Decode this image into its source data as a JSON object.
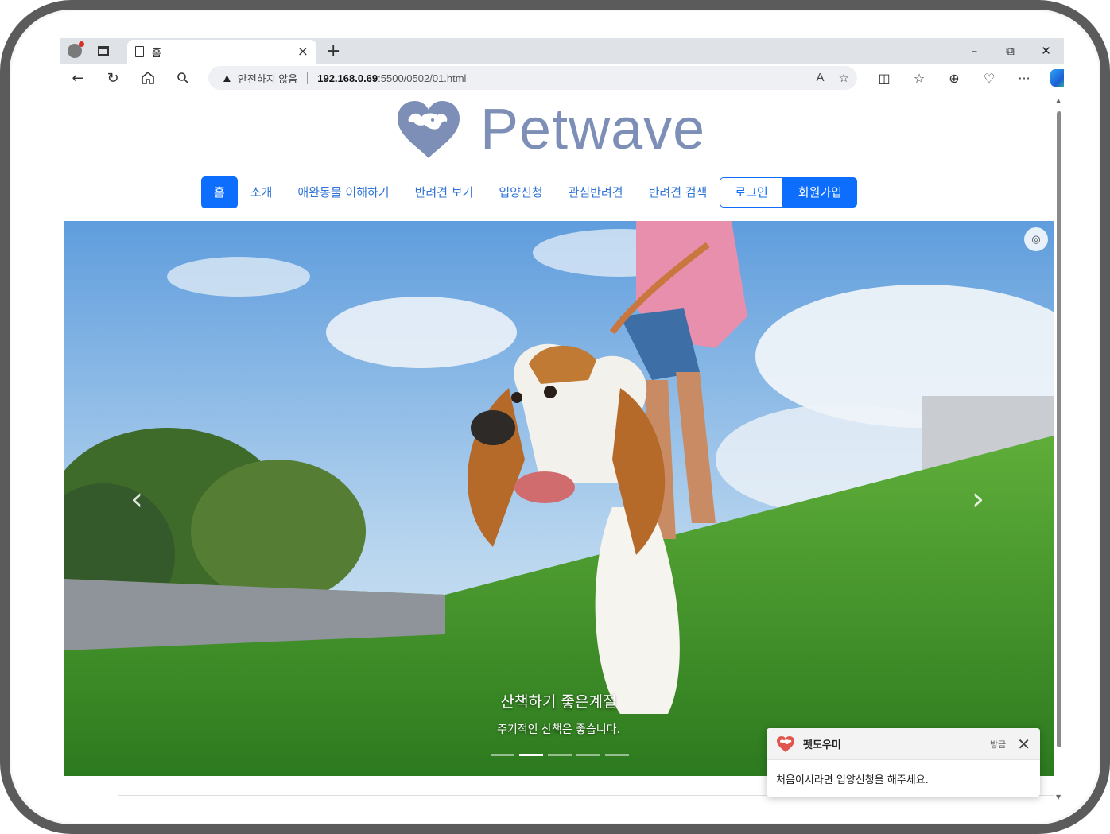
{
  "browser": {
    "tab_title": "홈",
    "tab_close": "×",
    "new_tab": "+",
    "window_controls": {
      "minimize": "–",
      "restore": "⧉",
      "close": "✕"
    },
    "address": {
      "security_label": "안전하지 않음",
      "url_host": "192.168.0.69",
      "url_rest": ":5500/0502/01.html"
    },
    "read_aloud": "A",
    "favorite": "☆",
    "toolbar_more": "···"
  },
  "site": {
    "brand": "Petwave",
    "brand_color": "#7d8fb6",
    "nav": [
      {
        "label": "홈",
        "active": true
      },
      {
        "label": "소개"
      },
      {
        "label": "애완동물 이해하기"
      },
      {
        "label": "반려견 보기"
      },
      {
        "label": "입양신청"
      },
      {
        "label": "관심반려견"
      },
      {
        "label": "반려견 검색"
      }
    ],
    "login_label": "로그인",
    "signup_label": "회원가입",
    "accent_color": "#0d6efd"
  },
  "carousel": {
    "caption_title": "산책하기 좋은계절",
    "caption_sub": "주기적인 산책은 좋습니다.",
    "prev": "‹",
    "next": "›",
    "slide_count": 5,
    "active_slide": 2
  },
  "toast": {
    "title": "펫도우미",
    "time": "방금",
    "body": "처음이시라면 입양신청을 해주세요.",
    "close": "✕"
  }
}
